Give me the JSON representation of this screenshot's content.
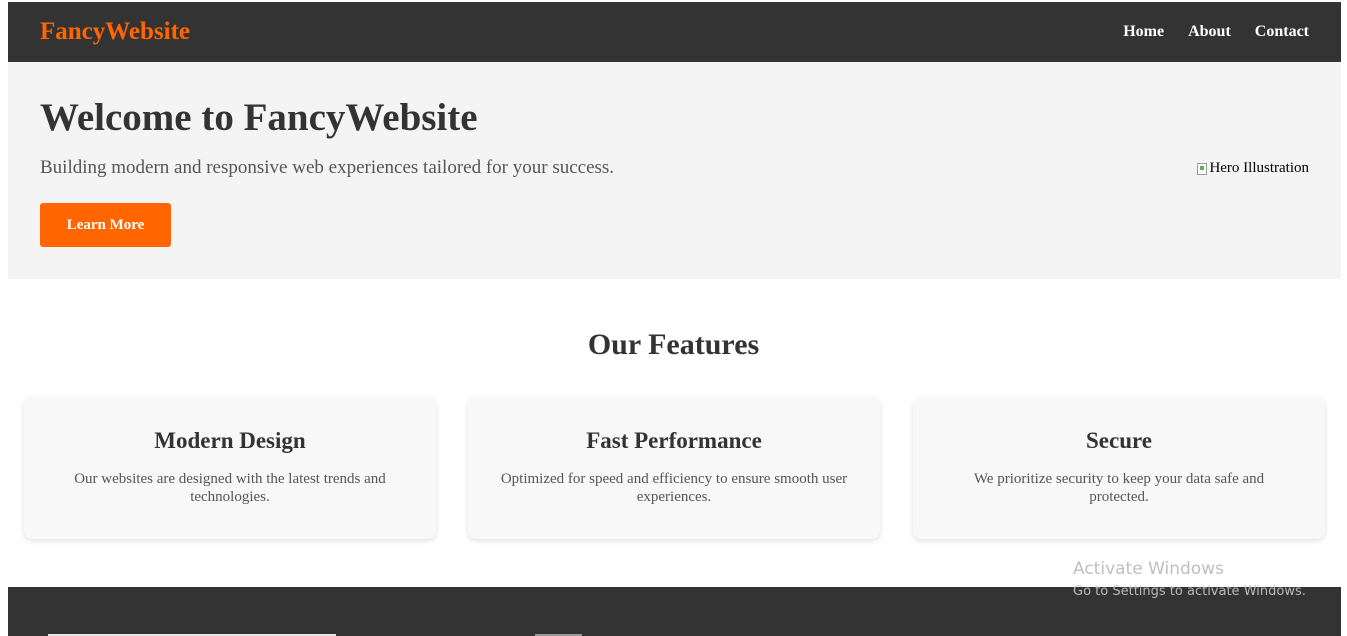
{
  "colors": {
    "brand": "#ff6600",
    "navbar_bg": "#333333",
    "hero_bg": "#f4f4f4",
    "card_bg": "#f8f8f8",
    "text_dark": "#333333",
    "text_muted": "#555555"
  },
  "header": {
    "logo": "FancyWebsite",
    "nav": [
      {
        "label": "Home"
      },
      {
        "label": "About"
      },
      {
        "label": "Contact"
      }
    ]
  },
  "hero": {
    "title": "Welcome to FancyWebsite",
    "subtitle": "Building modern and responsive web experiences tailored for your success.",
    "button_label": "Learn More",
    "image_alt": "Hero Illustration",
    "image_icon": "broken-image-icon"
  },
  "features": {
    "title": "Our Features",
    "cards": [
      {
        "title": "Modern Design",
        "description": "Our websites are designed with the latest trends and technologies."
      },
      {
        "title": "Fast Performance",
        "description": "Optimized for speed and efficiency to ensure smooth user experiences."
      },
      {
        "title": "Secure",
        "description": "We prioritize security to keep your data safe and protected."
      }
    ]
  },
  "watermark": {
    "title": "Activate Windows",
    "subtitle": "Go to Settings to activate Windows."
  }
}
